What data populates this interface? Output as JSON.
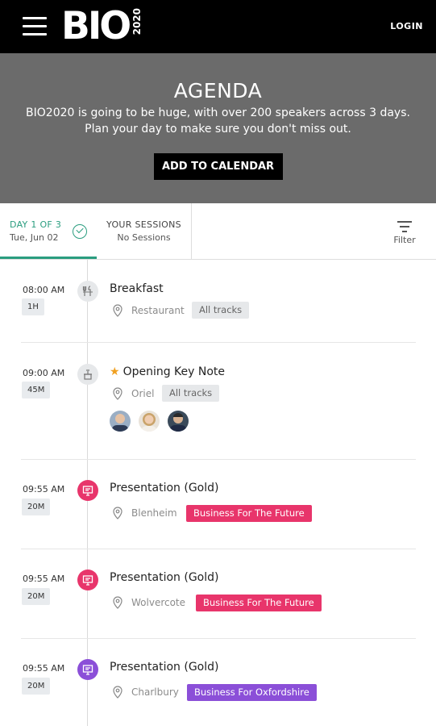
{
  "header": {
    "logo_text": "BIO",
    "logo_year": "2020",
    "login_label": "LOGIN"
  },
  "hero": {
    "title": "AGENDA",
    "line1": "BIO2020 is going to be huge, with over 200 speakers across 3 days.",
    "line2": "Plan your day to make sure you don't miss out.",
    "button_label": "ADD TO CALENDAR"
  },
  "tabs": {
    "day": {
      "label": "DAY 1 OF 3",
      "date": "Tue, Jun 02"
    },
    "sessions": {
      "label": "YOUR SESSIONS",
      "sub": "No Sessions"
    },
    "filter_label": "Filter"
  },
  "sessions": [
    {
      "time": "08:00 AM",
      "duration": "1H",
      "icon": "cutlery-icon",
      "title": "Breakfast",
      "starred": false,
      "location": "Restaurant",
      "tag": "All tracks",
      "tag_color": "#e6e8ea"
    },
    {
      "time": "09:00 AM",
      "duration": "45M",
      "icon": "podium-icon",
      "title": "Opening Key Note",
      "starred": true,
      "location": "Oriel",
      "tag": "All tracks",
      "tag_color": "#e6e8ea",
      "speakers": 3
    },
    {
      "time": "09:55 AM",
      "duration": "20M",
      "icon": "presentation-icon",
      "title": "Presentation (Gold)",
      "starred": false,
      "location": "Blenheim",
      "tag": "Business For The Future",
      "tag_color": "#e8356b"
    },
    {
      "time": "09:55 AM",
      "duration": "20M",
      "icon": "presentation-icon",
      "title": "Presentation (Gold)",
      "starred": false,
      "location": "Wolvercote",
      "tag": "Business For The Future",
      "tag_color": "#e8356b"
    },
    {
      "time": "09:55 AM",
      "duration": "20M",
      "icon": "presentation-icon",
      "title": "Presentation (Gold)",
      "starred": false,
      "location": "Charlbury",
      "tag": "Business For Oxfordshire",
      "tag_color": "#8b4fd8"
    }
  ],
  "colors": {
    "accent": "#2a9d7f",
    "pink": "#e8356b",
    "purple": "#8b4fd8"
  }
}
